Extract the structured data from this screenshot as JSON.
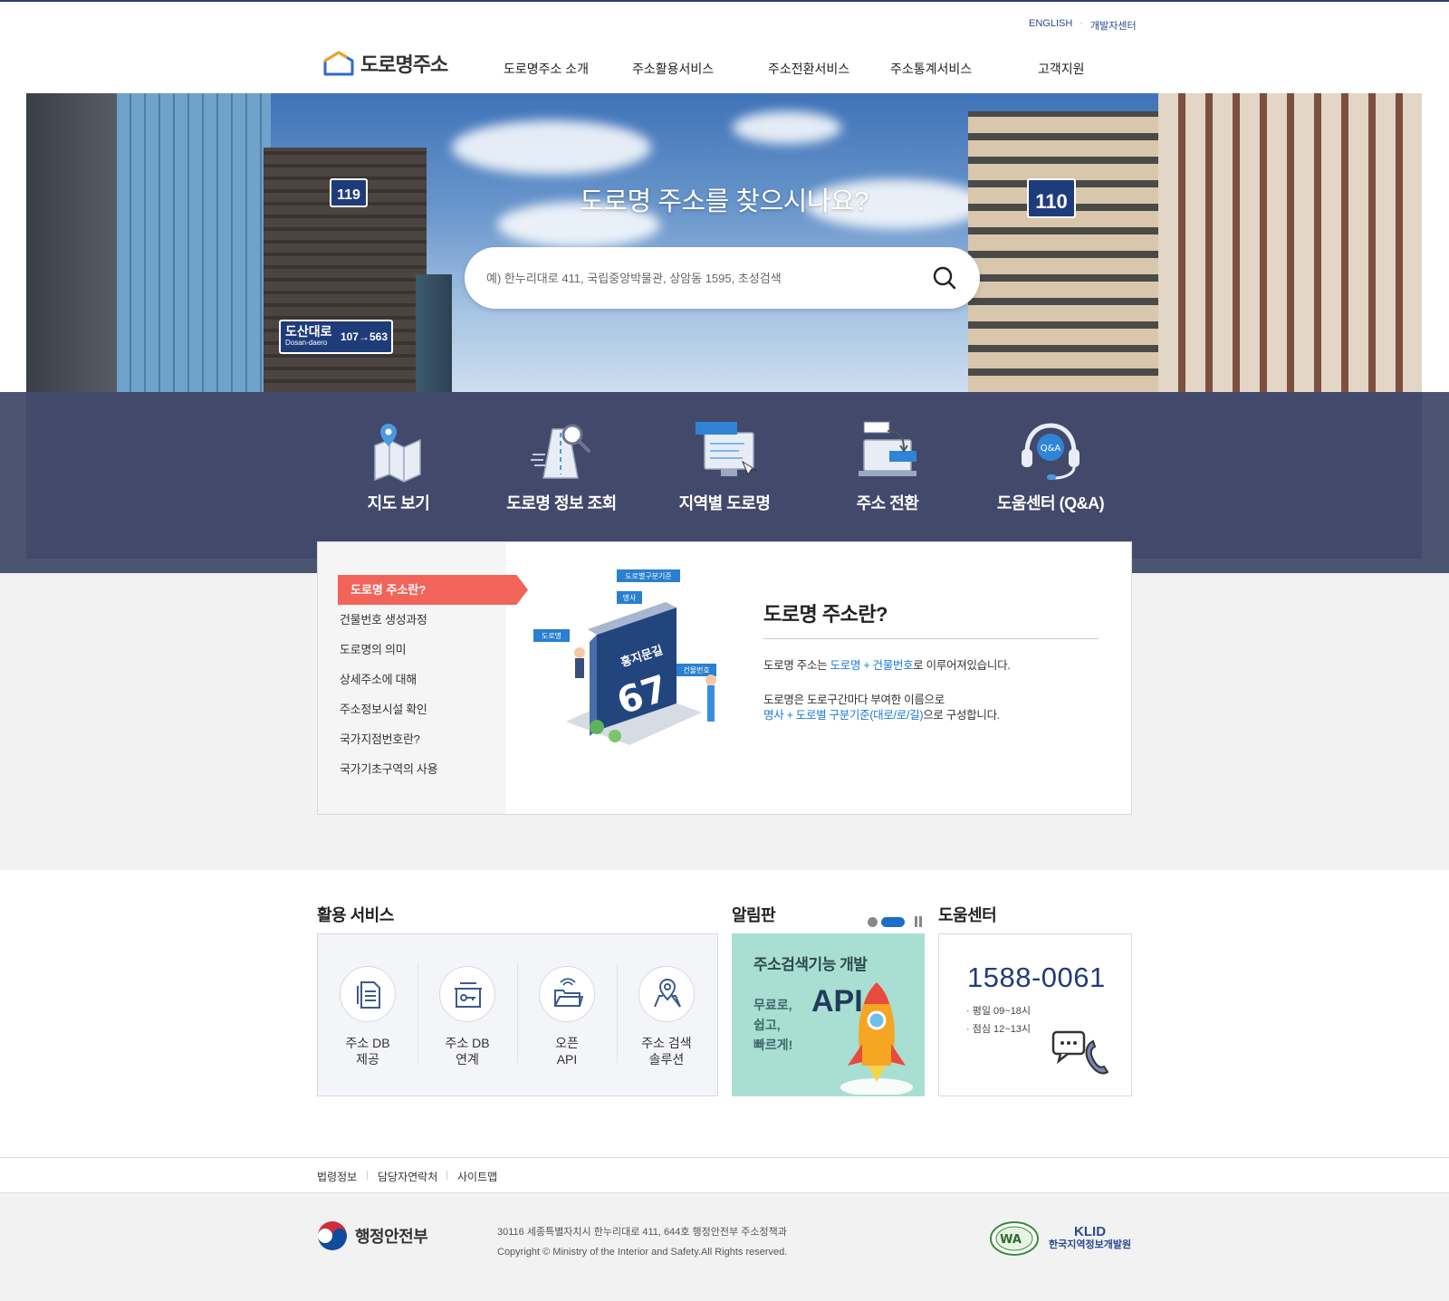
{
  "header": {
    "util_links": [
      "ENGLISH",
      "개발자센터"
    ],
    "logo_text": "도로명주소",
    "nav": [
      "도로명주소 소개",
      "주소활용서비스",
      "주소전환서비스",
      "주소통계서비스",
      "고객지원"
    ]
  },
  "hero": {
    "title": "도로명 주소를 찾으시나요?",
    "search_placeholder": "예) 한누리대로 411, 국립중앙박물관, 상암동 1595, 초성검색",
    "signs": {
      "left_number": "119",
      "right_number": "110",
      "road_name": "도산대로",
      "road_name_en": "Dosan-daero",
      "road_range": "107→563"
    }
  },
  "quick_menu": [
    "지도 보기",
    "도로명 정보 조회",
    "지역별 도로명",
    "주소 전환",
    "도움센터 (Q&A)"
  ],
  "intro": {
    "side_active": "도로명 주소란?",
    "side_items": [
      "건물번호 생성과정",
      "도로명의 의미",
      "상세주소에 대해",
      "주소정보시설 확인",
      "국가지점번호란?",
      "국가기초구역의 사용"
    ],
    "illustration_tags": [
      "도로별구분기준",
      "명사",
      "도로명",
      "건물번호"
    ],
    "illustration_sign_text": "홍지문길",
    "illustration_sign_number": "67",
    "title": "도로명 주소란?",
    "p1_before": "도로명 주소는 ",
    "p1_highlight": "도로명 + 건물번호",
    "p1_after": "로 이루어져있습니다.",
    "p2_line1": "도로명은 도로구간마다 부여한 이름으로",
    "p2_highlight": "명사 + 도로별 구분기준(대로/로/길)",
    "p2_after": "으로 구성합니다."
  },
  "services": {
    "title": "활용 서비스",
    "items": [
      {
        "line1": "주소 DB",
        "line2": "제공",
        "icon": "document-icon"
      },
      {
        "line1": "주소 DB",
        "line2": "연계",
        "icon": "link-box-icon"
      },
      {
        "line1": "오픈",
        "line2": "API",
        "icon": "open-folder-icon"
      },
      {
        "line1": "주소 검색",
        "line2": "솔루션",
        "icon": "map-pin-icon"
      }
    ]
  },
  "notice": {
    "title": "알림판",
    "banner_title": "주소검색기능 개발",
    "banner_lines": [
      "무료로,",
      "쉽고,",
      "빠르게!"
    ],
    "banner_api": "API"
  },
  "help": {
    "title": "도움센터",
    "phone": "1588-0061",
    "hours": [
      "평일 09~18시",
      "점심 12~13시"
    ]
  },
  "footer": {
    "links": [
      "법령정보",
      "담당자연락처",
      "사이트맵"
    ],
    "ministry": "행정안전부",
    "address": "30116 세종특별자치시 한누리대로 411, 644호 행정안전부 주소정책과",
    "copyright": "Copyright © Ministry of the Interior and Safety.All Rights reserved.",
    "klid_logo_text": "KLID",
    "klid_name": "한국지역정보개발원"
  },
  "colors": {
    "nav_dark": "#28416b",
    "accent_red": "#f2635a",
    "link_blue": "#1a7ad6",
    "band": "#4b5571"
  }
}
